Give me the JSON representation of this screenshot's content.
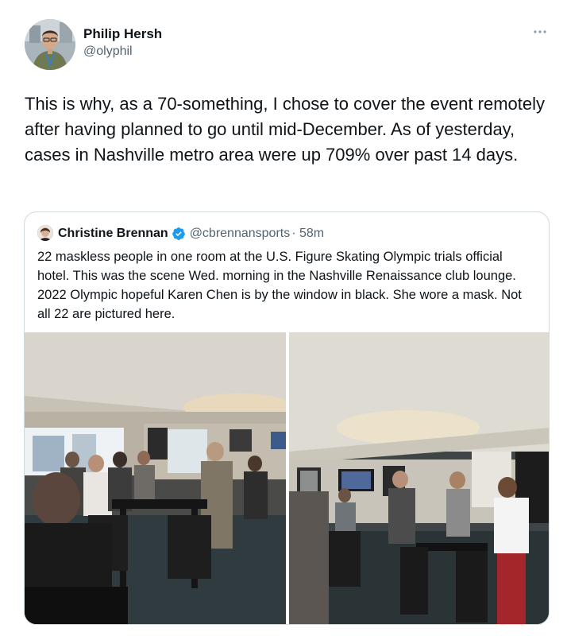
{
  "author": {
    "name": "Philip Hersh",
    "handle": "@olyphil",
    "more_icon": "more-horizontal-icon"
  },
  "tweet": {
    "text": "This is why, as a 70-something, I chose to cover the event remotely after having planned to go until mid-December.  As of yesterday, cases in Nashville metro area were up 709% over past 14 days."
  },
  "quoted_tweet": {
    "name": "Christine Brennan",
    "verified_icon": "verified-badge-icon",
    "handle": "@cbrennansports",
    "time": "· 58m",
    "text": "22 maskless people in one room at the U.S. Figure Skating Olympic trials official hotel. This was the scene Wed. morning in the Nashville Renaissance club lounge. 2022 Olympic hopeful Karen Chen is by the window in black. She wore a mask. Not all 22 are pictured here.",
    "colors": {
      "verified": "#1d9bf0",
      "border": "#cfd9de"
    }
  }
}
